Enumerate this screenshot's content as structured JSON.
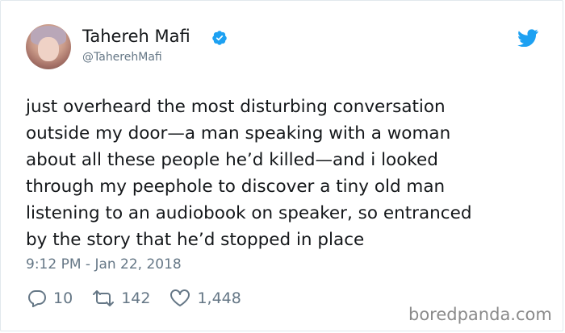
{
  "author": {
    "display_name": "Tahereh Mafi",
    "handle": "@TaherehMafi",
    "verified_icon": "verified-badge-icon",
    "avatar": "profile-avatar"
  },
  "tweet": {
    "text": "just overheard the most disturbing conversation\noutside my door—a man speaking with a woman\nabout all these people he’d killed—and i looked\nthrough my peephole to discover a tiny old man\nlistening to an audiobook on speaker, so entranced\nby the story that he’d stopped in place",
    "timestamp": "9:12 PM - Jan 22, 2018"
  },
  "actions": {
    "replies": "10",
    "retweets": "142",
    "likes": "1,448"
  },
  "icons": {
    "logo": "twitter-bird-icon",
    "reply": "reply-icon",
    "retweet": "retweet-icon",
    "like": "heart-icon"
  },
  "watermark": "boredpanda.com",
  "colors": {
    "twitter_blue": "#1da1f2",
    "text": "#14171a",
    "muted": "#657786",
    "watermark": "#8a8a8a"
  }
}
